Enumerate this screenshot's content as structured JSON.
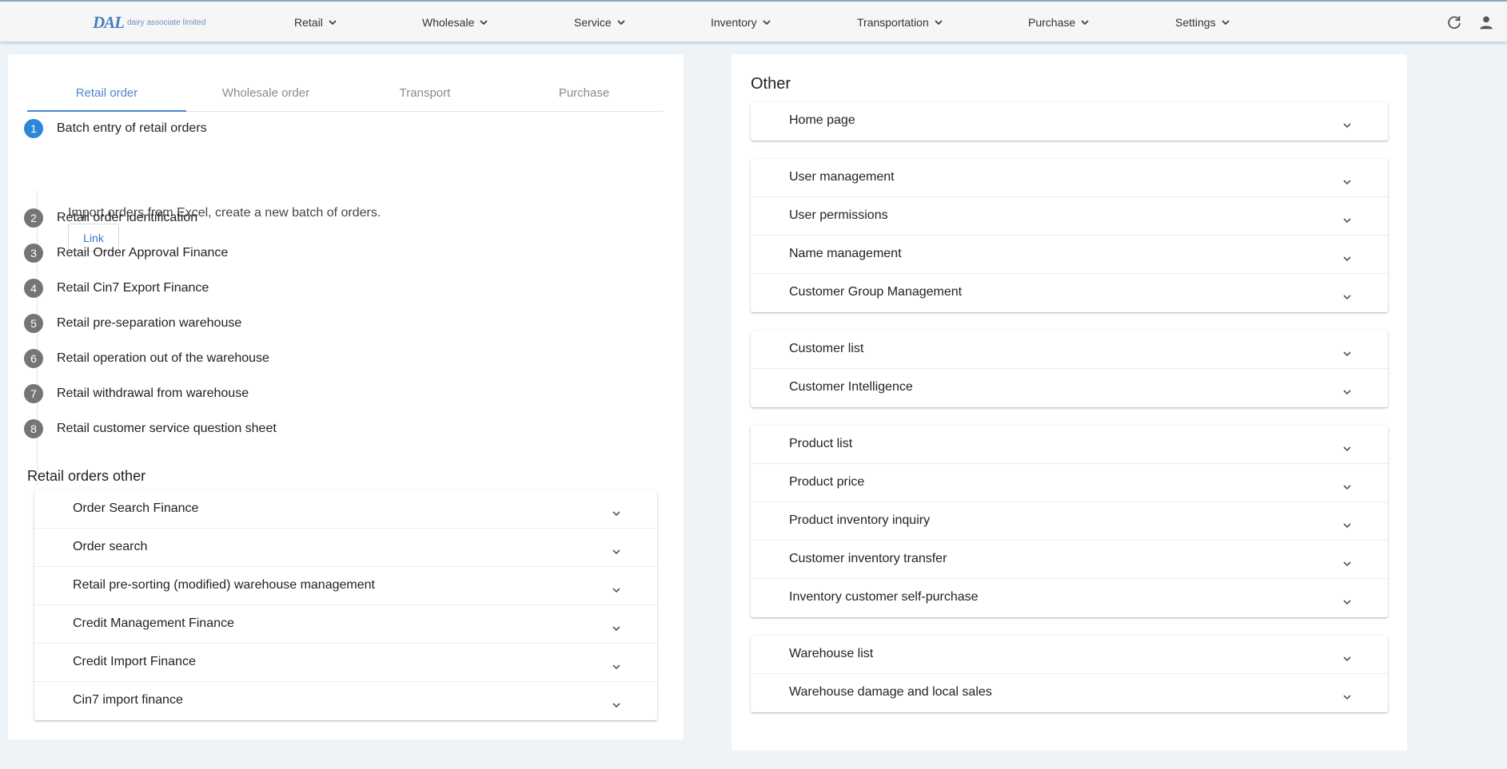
{
  "app": {
    "logo_mark": "DAL",
    "logo_text": "dairy associate limited"
  },
  "nav": [
    {
      "label": "Retail"
    },
    {
      "label": "Wholesale"
    },
    {
      "label": "Service"
    },
    {
      "label": "Inventory"
    },
    {
      "label": "Transportation"
    },
    {
      "label": "Purchase"
    },
    {
      "label": "Settings"
    }
  ],
  "tabs": [
    {
      "label": "Retail order"
    },
    {
      "label": "Wholesale order"
    },
    {
      "label": "Transport"
    },
    {
      "label": "Purchase"
    }
  ],
  "steps": [
    {
      "num": "1",
      "label": "Batch entry of retail orders"
    },
    {
      "num": "2",
      "label": "Retail order identification"
    },
    {
      "num": "3",
      "label": "Retail Order Approval Finance"
    },
    {
      "num": "4",
      "label": "Retail Cin7 Export Finance"
    },
    {
      "num": "5",
      "label": "Retail pre-separation warehouse"
    },
    {
      "num": "6",
      "label": "Retail operation out of the warehouse"
    },
    {
      "num": "7",
      "label": "Retail withdrawal from warehouse"
    },
    {
      "num": "8",
      "label": "Retail customer service question sheet"
    }
  ],
  "active_step": {
    "description": "Import orders from Excel, create a new batch of orders.",
    "link_label": "Link"
  },
  "retail_other": {
    "title": "Retail orders other",
    "items": [
      "Order Search Finance",
      "Order search",
      "Retail pre-sorting (modified) warehouse management",
      "Credit Management Finance",
      "Credit Import Finance",
      "Cin7 import finance"
    ]
  },
  "other": {
    "title": "Other",
    "groups": [
      [
        "Home page"
      ],
      [
        "User management",
        "User permissions",
        "Name management",
        "Customer Group Management"
      ],
      [
        "Customer list",
        "Customer Intelligence"
      ],
      [
        "Product list",
        "Product price",
        "Product inventory inquiry",
        "Customer inventory transfer",
        "Inventory customer self-purchase"
      ],
      [
        "Warehouse list",
        "Warehouse damage and local sales"
      ]
    ]
  },
  "colors": {
    "accent": "#4c86cf",
    "active_step": "#2f86d9",
    "inactive_step": "#757575"
  }
}
